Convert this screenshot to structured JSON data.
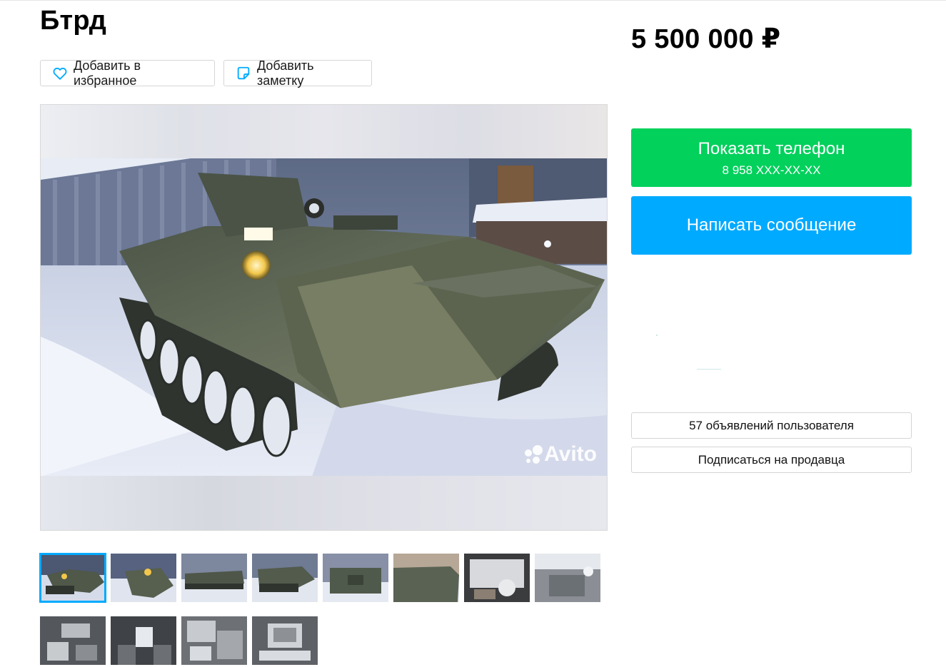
{
  "listing": {
    "title": "Бтрд",
    "price": "5 500 000 ₽"
  },
  "actions": {
    "favorite_label": "Добавить в избранное",
    "note_label": "Добавить заметку"
  },
  "contact": {
    "show_phone_label": "Показать телефон",
    "phone_masked": "8 958 XXX-XX-XX",
    "message_label": "Написать сообщение"
  },
  "seller": {
    "ads_count_label": "57 объявлений пользователя",
    "subscribe_label": "Подписаться на продавца"
  },
  "gallery": {
    "watermark": "Avito",
    "thumbnails": [
      "photo-1",
      "photo-2",
      "photo-3",
      "photo-4",
      "photo-5",
      "photo-6",
      "photo-7",
      "photo-8",
      "photo-9",
      "photo-10",
      "photo-11",
      "photo-12"
    ],
    "active_index": 0
  },
  "colors": {
    "green": "#02d15c",
    "blue": "#00aaff",
    "border": "#d4d4d4"
  }
}
